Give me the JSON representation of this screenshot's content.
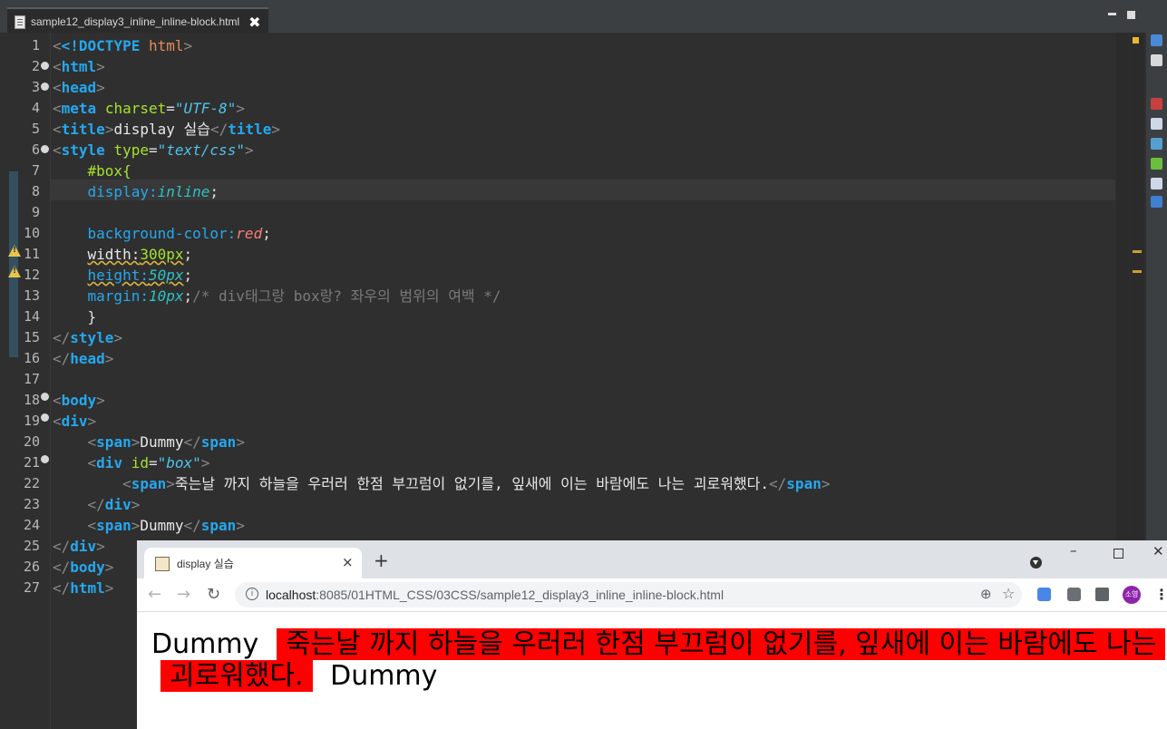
{
  "editor": {
    "tab_filename": "sample12_display3_inline_inline-block.html",
    "tab_close": "✖",
    "line_numbers": [
      "1",
      "2",
      "3",
      "4",
      "5",
      "6",
      "7",
      "8",
      "9",
      "10",
      "11",
      "12",
      "13",
      "14",
      "15",
      "16",
      "17",
      "18",
      "19",
      "20",
      "21",
      "22",
      "23",
      "24",
      "25",
      "26",
      "27"
    ],
    "code": {
      "l1_doctype": "<!DOCTYPE",
      "l1_html": " html",
      "l1_end": ">",
      "l5_title_text": "display 실습",
      "l6_type_val": "\"text/css\"",
      "l4_charset_val": "\"UTF-8\"",
      "l7_selector": "#box{",
      "l8_prop": "display:",
      "l8_val": "inline",
      "l10_prop": "background-color:",
      "l10_val": "red",
      "l11_prop": "width:",
      "l11_val": "300px",
      "l12_prop": "height:",
      "l12_val": "50px",
      "l13_prop": "margin:",
      "l13_val": "10px",
      "l13_comment": "/* div태그랑 box랑? 좌우의 범위의 여백 */",
      "l14_brace": "}",
      "l20_text": "Dummy",
      "l21_id_val": "\"box\"",
      "l22_text": "죽는날 까지 하늘을 우러러 한점 부끄럼이 없기를, 잎새에 이는 바람에도 나는 괴로워했다.",
      "l24_text": "Dummy"
    }
  },
  "browser": {
    "tab_title": "display 실습",
    "tab_close": "×",
    "new_tab": "+",
    "min": "–",
    "close": "✕",
    "url_host": "localhost",
    "url_rest": ":8085/01HTML_CSS/03CSS/sample12_display3_inline_inline-block.html",
    "profile": "소영",
    "page": {
      "dummy1": "Dummy",
      "box_text": "죽는날 까지 하늘을 우러러 한점 부끄럼이 없기를, 잎새에 이는 바람에도 나는 괴로워했다.",
      "dummy2": "Dummy"
    }
  },
  "colors": {
    "box_background": "#ff0000",
    "editor_background": "#2f2f2f",
    "tag_color": "#25a8ef"
  }
}
